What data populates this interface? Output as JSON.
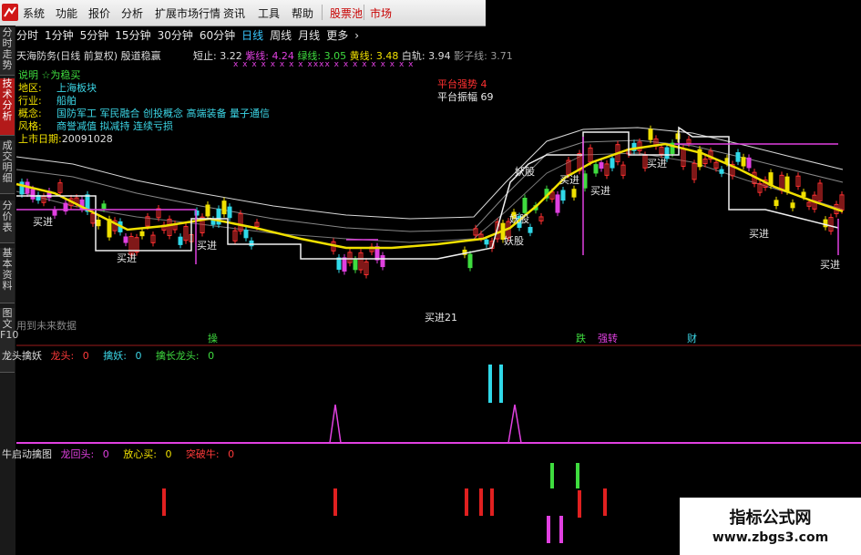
{
  "menu": {
    "items": [
      "系统",
      "功能",
      "报价",
      "分析",
      "扩展市场行情",
      "资讯",
      "工具",
      "帮助"
    ],
    "special": [
      "股票池",
      "市场"
    ]
  },
  "side_tabs": [
    "分时走势",
    "技术分析",
    "成交明细",
    "分价表",
    "基本资料",
    "图文F10"
  ],
  "periods": [
    "分时",
    "1分钟",
    "5分钟",
    "15分钟",
    "30分钟",
    "60分钟",
    "日线",
    "周线",
    "月线",
    "更多",
    "›"
  ],
  "selected_period": "日线",
  "chart": {
    "title": "天海防务(日线 前复权) 殷道稳赢",
    "short_stop_label": "短止:",
    "short_stop_value": "3.22",
    "purple_line_label": "紫线:",
    "purple_line_value": "4.24",
    "green_line_label": "绿线:",
    "green_line_value": "3.05",
    "yellow_line_label": "黄线:",
    "yellow_line_value": "3.48",
    "white_line_label": "白轨:",
    "white_line_value": "3.94",
    "shadow_line_label": "影子线:",
    "shadow_line_value": "3.71",
    "marker_row": "x x x x  x x  x x  xxxx  x x x  x x  x x x  x",
    "right_note_1": "平台强势 4",
    "right_note_2": "平台振幅 69",
    "future_text": "用到未来数据",
    "annotation_bottom": "买进21",
    "bottom_markers": [
      "操",
      "跌",
      "强转",
      "财"
    ]
  },
  "info": {
    "note": "说明  ☆为稳买",
    "region_label": "地区:",
    "region_value": "上海板块",
    "industry_label": "行业:",
    "industry_value": "船舶",
    "concept_label": "概念:",
    "concept_value": "国防军工 军民融合 创投概念 高端装备 量子通信",
    "style_label": "风格:",
    "style_value": "商誉减值 拟减持 连续亏损",
    "listing_label": "上市日期:",
    "listing_value": "20091028"
  },
  "signals": [
    "买进",
    "买进",
    "买进",
    "妖股",
    "妖股",
    "妖股",
    "买进",
    "买进",
    "买进",
    "买进",
    "买进"
  ],
  "panel1": {
    "name": "龙头擒妖",
    "f1_label": "龙头:",
    "f1_value": "0",
    "f2_label": "擒妖:",
    "f2_value": "0",
    "f3_label": "擒长龙头:",
    "f3_value": "0"
  },
  "panel2": {
    "name": "牛启动擒图",
    "f1_label": "龙回头:",
    "f1_value": "0",
    "f2_label": "放心买:",
    "f2_value": "0",
    "f3_label": "突破牛:",
    "f3_value": "0"
  },
  "watermark": {
    "title": "指标公式网",
    "url": "www.zbgs3.com"
  },
  "colors": {
    "up": "#ff3030",
    "down": "#30d8e8",
    "yellow": "#f0e000",
    "magenta": "#e040e0",
    "green": "#3fdc3f",
    "white": "#e8e8e8"
  }
}
